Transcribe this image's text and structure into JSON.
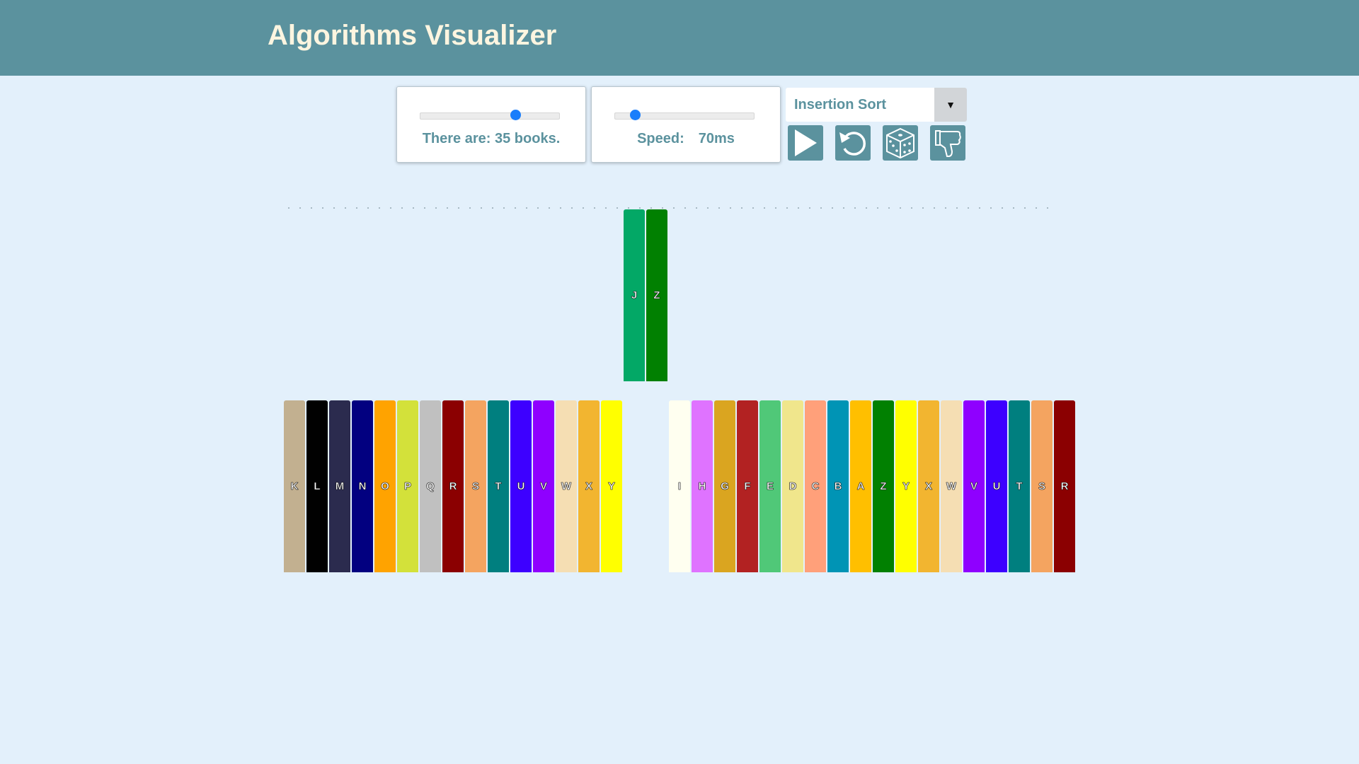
{
  "app": {
    "title": "Algorithms Visualizer"
  },
  "books_panel": {
    "prefix": "There are:",
    "count_text": "35 books.",
    "slider_fraction": 0.69
  },
  "speed_panel": {
    "label": "Speed:",
    "value_text": "70ms",
    "slider_fraction": 0.15
  },
  "algorithm_select": {
    "selected": "Insertion Sort",
    "arrow": "▼"
  },
  "controls": [
    {
      "name": "play-button",
      "icon": "play-icon"
    },
    {
      "name": "reset-button",
      "icon": "reset-icon"
    },
    {
      "name": "shuffle-button",
      "icon": "dice-icon"
    },
    {
      "name": "worst-case-button",
      "icon": "thumbs-down-icon"
    }
  ],
  "colors": {
    "header": "#5b929e",
    "background": "#e3f0fb",
    "accent": "#1a7efb"
  },
  "lifted_books": [
    {
      "letter": "J",
      "color": "#03a866"
    },
    {
      "letter": "Z",
      "color": "#018001"
    }
  ],
  "shelf_left": [
    {
      "letter": "K",
      "color": "#c2b090"
    },
    {
      "letter": "L",
      "color": "#010101"
    },
    {
      "letter": "M",
      "color": "#2b2b4e"
    },
    {
      "letter": "N",
      "color": "#020080"
    },
    {
      "letter": "O",
      "color": "#ffa300"
    },
    {
      "letter": "P",
      "color": "#d3e13a"
    },
    {
      "letter": "Q",
      "color": "#c0c0c0"
    },
    {
      "letter": "R",
      "color": "#8b0001"
    },
    {
      "letter": "S",
      "color": "#f4a460"
    },
    {
      "letter": "T",
      "color": "#007f7f"
    },
    {
      "letter": "U",
      "color": "#3d00ff"
    },
    {
      "letter": "V",
      "color": "#8f00ff"
    },
    {
      "letter": "W",
      "color": "#f5deb3"
    },
    {
      "letter": "X",
      "color": "#f2b530"
    },
    {
      "letter": "Y",
      "color": "#ffff00"
    }
  ],
  "shelf_right": [
    {
      "letter": "I",
      "color": "#fffff0"
    },
    {
      "letter": "H",
      "color": "#df73ff"
    },
    {
      "letter": "G",
      "color": "#daa520"
    },
    {
      "letter": "F",
      "color": "#b22222"
    },
    {
      "letter": "E",
      "color": "#50c878"
    },
    {
      "letter": "D",
      "color": "#f0e68c"
    },
    {
      "letter": "C",
      "color": "#ffa07a"
    },
    {
      "letter": "B",
      "color": "#0094b5"
    },
    {
      "letter": "A",
      "color": "#ffbf00"
    },
    {
      "letter": "Z",
      "color": "#018001"
    },
    {
      "letter": "Y",
      "color": "#ffff00"
    },
    {
      "letter": "X",
      "color": "#f2b530"
    },
    {
      "letter": "W",
      "color": "#f5deb3"
    },
    {
      "letter": "V",
      "color": "#8f00ff"
    },
    {
      "letter": "U",
      "color": "#3d00ff"
    },
    {
      "letter": "T",
      "color": "#007f7f"
    },
    {
      "letter": "S",
      "color": "#f4a460"
    },
    {
      "letter": "R",
      "color": "#8b0001"
    }
  ]
}
